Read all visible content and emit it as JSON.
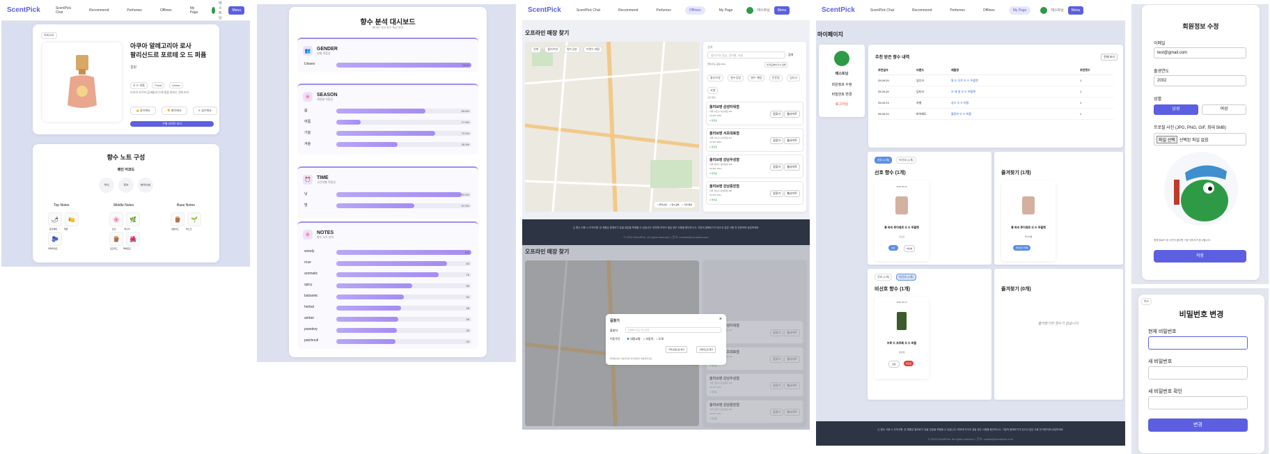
{
  "nav": {
    "logo": "ScentPick",
    "links": [
      "ScentPick Chat",
      "Recommend",
      "Perfumes",
      "Offlines",
      "My Page"
    ],
    "user": "테스트님",
    "menu": "Menu"
  },
  "product": {
    "back": "목록으로",
    "name_line1": "아쿠아 알레고리아 로사",
    "name_line2": "팔리산드르 포르테 오 드 퍼퓸",
    "brand": "겔랑",
    "tags": [
      "오 드 퍼퓸",
      "Floral",
      "Unisex"
    ],
    "desc": "다리의 조르자 잎새들과 다채 빛을 발하는 장미조차",
    "actions": [
      "좋아해요",
      "별로예요",
      "싫어해요"
    ],
    "buy": "구매 사이트 보기"
  },
  "notes": {
    "title": "향수 노트 구성",
    "main_title": "메인 어코드",
    "main": [
      "우디",
      "로즈",
      "파우더리"
    ],
    "top_title": "Top Notes",
    "top": [
      "핑크페퍼",
      "레몬"
    ],
    "top2": "블랙커런트",
    "middle_title": "Middle Notes",
    "middle": [
      "로즈",
      "파출리"
    ],
    "middle2": [
      "로즈우드",
      "투베로즈"
    ],
    "base_title": "Base Notes",
    "base": [
      "샌달우드",
      "머스크"
    ]
  },
  "analysis": {
    "title": "향수 분석 대시보드",
    "subtitle": "데이터 기반 향수 특성 분석",
    "gender": {
      "title": "GENDER",
      "sub": "성별 적합성",
      "rows": [
        {
          "label": "Unisex",
          "pct": "100%",
          "v": 1.0
        }
      ]
    },
    "season": {
      "title": "SEASON",
      "sub": "계절별 적합성",
      "rows": [
        {
          "label": "봄",
          "pct": "65.8%",
          "v": 0.658
        },
        {
          "label": "여름",
          "pct": "17.8%",
          "v": 0.178
        },
        {
          "label": "가을",
          "pct": "73.2%",
          "v": 0.732
        },
        {
          "label": "겨울",
          "pct": "45.3%",
          "v": 0.453
        }
      ]
    },
    "time": {
      "title": "TIME",
      "sub": "시간대별 적합성",
      "rows": [
        {
          "label": "낮",
          "pct": "93.0%",
          "v": 0.93
        },
        {
          "label": "밤",
          "pct": "57.9%",
          "v": 0.579
        }
      ]
    },
    "notes": {
      "title": "NOTES",
      "sub": "향수 노트 분석",
      "rows": [
        {
          "label": "woody",
          "pct": "100",
          "v": 1.0
        },
        {
          "label": "rose",
          "pct": "82",
          "v": 0.82
        },
        {
          "label": "aromatic",
          "pct": "76",
          "v": 0.76
        },
        {
          "label": "spicy",
          "pct": "56",
          "v": 0.56
        },
        {
          "label": "balsamic",
          "pct": "50",
          "v": 0.5
        },
        {
          "label": "herbal",
          "pct": "48",
          "v": 0.48
        },
        {
          "label": "amber",
          "pct": "46",
          "v": 0.46
        },
        {
          "label": "powdery",
          "pct": "45",
          "v": 0.45
        },
        {
          "label": "patchouli",
          "pct": "44",
          "v": 0.44
        }
      ]
    }
  },
  "offline": {
    "title": "오프라인 매장 찾기",
    "map_tabs": [
      "전체",
      "올리브영",
      "향수공방",
      "브랜드 매장"
    ],
    "search_label": "검색",
    "search_ph": "올리브영 강남, 갈비젤, 서울",
    "search_btn": "검색",
    "radius_text": "현재 지도 중심 10km",
    "nearby": "내 지도에서 다시 검색",
    "chips": [
      "올리브영",
      "향수공방",
      "향수 매장",
      "전문점",
      "딥티크",
      "샤넬"
    ],
    "list_label": "검색 결과",
    "stores": [
      {
        "name": "올리브영 삼성타워점",
        "addr": "서울 서초구 서초대로 320",
        "tel": "02-587-1645",
        "status": "영업중"
      },
      {
        "name": "올리브영 서초대로점",
        "addr": "서울 서초구 서초대로 314",
        "tel": "02-587-9956",
        "status": "영업중"
      },
      {
        "name": "올리브영 강남우성점",
        "addr": "서울 강남구 강남대로 328",
        "tel": "02-587-1234",
        "status": "영업중"
      },
      {
        "name": "올리브영 강남중앙점",
        "addr": "서울 강남구 강남대로 380",
        "tel": "02-587-4321",
        "status": "영업중"
      }
    ],
    "store_btns": [
      "길찾기",
      "웹사이트"
    ],
    "legend": [
      "올리브영",
      "향수공방",
      "기타 매장"
    ],
    "footer1": "⚠ 향수 사용 시 주의사항: 본 제품은 알레르기 유발 성분을 포함할 수 있습니다. 피부에 자극이 생길 경우 사용을 중단하시고, 기존의 알레르기가 있으신 분은 사용 전 전문의와 상담하세요.",
    "footer2": "© 2024 ScentPick. All rights reserved. | 문의: contact@scentpick.com"
  },
  "directions": {
    "title": "길찾기",
    "close": "×",
    "from_label": "출발지",
    "from_ph": "현재위치 또는 주소 입력",
    "mode_label": "이동수단",
    "modes": [
      "대중교통",
      "자동차",
      "도보"
    ],
    "btns": [
      "카카오맵으로 열기",
      "구글지도로 열기"
    ],
    "hint": "현재위치를 사용하려면 위치권한을 허용해주세요"
  },
  "mypage": {
    "title": "마이페이지",
    "profile_name": "테스트님",
    "menu": [
      "회원정보 수정",
      "비밀번호 변경",
      "로그아웃"
    ],
    "history_title": "추천 받은 향수 내역",
    "history_btn": "전체 보기",
    "history_cols": [
      "추천일자",
      "브랜드",
      "제품명",
      "추천횟수"
    ],
    "history_rows": [
      [
        "25.09.29",
        "딥디크",
        "필 드 무르 오 드 뚜왈렛",
        "1"
      ],
      [
        "25.09.29",
        "딥티크",
        "오 데 썽 오 드 뚜왈렛",
        "1"
      ],
      [
        "25.09.23",
        "샤넬",
        "샹스 오 드 퍼퓸",
        "1"
      ],
      [
        "25.09.23",
        "바이레도",
        "블랑쉬 오 드 퍼퓸",
        "1"
      ]
    ],
    "fav_tabs": [
      "선호 (1개)",
      "비선호 (1개)"
    ],
    "fav_title": "선호 향수 (1개)",
    "fav_date": "2025.09.29",
    "fav_name": "롱 파리 루이제르 오 드 뚜왈렛",
    "fav_brand": "디오르",
    "fav_btns": [
      "선호",
      "비선호"
    ],
    "bookmark_title": "즐겨찾기 (1개)",
    "bookmark_name": "롱 파리 루이제르 오 드 뚜왈렛",
    "bookmark_brand": "루이비통",
    "bookmark_btn": "즐겨찾기 해제",
    "dislike_title": "비선호 향수 (1개)",
    "dislike_date": "2025.09.29",
    "dislike_name": "브루 드 포르페 오 드 퍼퓸",
    "dislike_brand": "파르페",
    "bookmark_empty_title": "즐겨찾기 (0개)",
    "bookmark_empty": "즐겨찾기한 향수가 없습니다."
  },
  "edit": {
    "title": "회원정보 수정",
    "email_label": "이메일",
    "email": "test@gmail.com",
    "year_label": "출생연도",
    "year": "2002",
    "gender_label": "성별",
    "genders": [
      "남성",
      "여성"
    ],
    "photo_label": "프로필 사진 (JPG, PNG, GIF, 최대 5MB)",
    "file_btn": "파일 선택",
    "file_none": "선택된 파일 없음",
    "photo_hint": "현재 업로드 된 사진이 없다면 기본 이미지가 표시됩니다.",
    "save": "저장"
  },
  "pw": {
    "cancel": "취소",
    "title": "비밀번호 변경",
    "cur": "현재 비밀번호",
    "new": "새 비밀번호",
    "confirm": "새 비밀번호 확인",
    "submit": "변경"
  }
}
